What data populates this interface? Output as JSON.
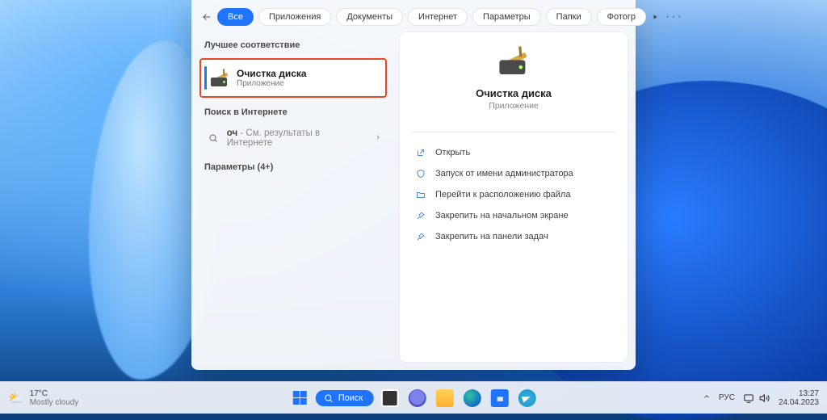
{
  "tabs": {
    "active": "Все",
    "items": [
      "Приложения",
      "Документы",
      "Интернет",
      "Параметры",
      "Папки",
      "Фотогр"
    ]
  },
  "left": {
    "best_match": "Лучшее соответствие",
    "result": {
      "title": "Очистка диска",
      "subtitle": "Приложение"
    },
    "web_header": "Поиск в Интернете",
    "web_row": {
      "prefix": "оч",
      "hint": " - См. результаты в Интернете"
    },
    "settings_header": "Параметры (4+)"
  },
  "right": {
    "title": "Очистка диска",
    "subtitle": "Приложение",
    "actions": [
      "Открыть",
      "Запуск от имени администратора",
      "Перейти к расположению файла",
      "Закрепить на начальном экране",
      "Закрепить на панели задач"
    ]
  },
  "taskbar": {
    "weather": {
      "temp": "17°C",
      "desc": "Mostly cloudy"
    },
    "search_label": "Поиск",
    "lang": "РУС",
    "time": "13:27",
    "date": "24.04.2023"
  }
}
